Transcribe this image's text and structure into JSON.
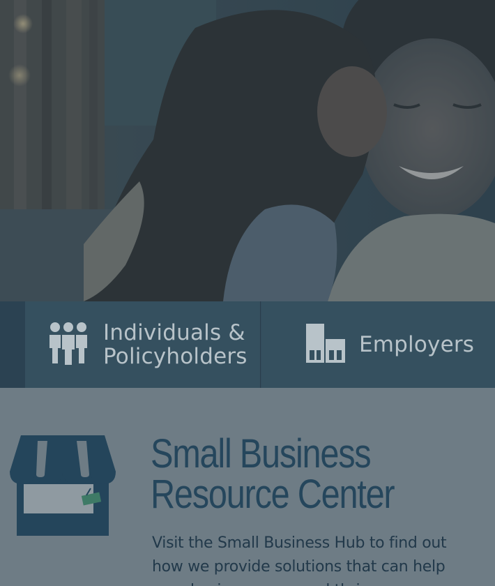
{
  "hero": {
    "image": "mother-and-daughter-kiss-photo"
  },
  "nav": {
    "individuals": {
      "line1": "Individuals &",
      "line2": "Policyholders",
      "icon": "people-group-icon"
    },
    "employers": {
      "label": "Employers",
      "icon": "buildings-icon"
    }
  },
  "small_business": {
    "icon": "storefront-icon",
    "title_line1": "Small Business",
    "title_line2": "Resource Center",
    "description": "Visit the Small Business Hub to find out how we provide solutions that can help your business grow and thrive."
  },
  "colors": {
    "nav_band": "#324a5c",
    "nav_text": "#b8c3c9",
    "page_background": "#6e7c85",
    "heading": "#25465c",
    "body_text": "#22394a"
  }
}
